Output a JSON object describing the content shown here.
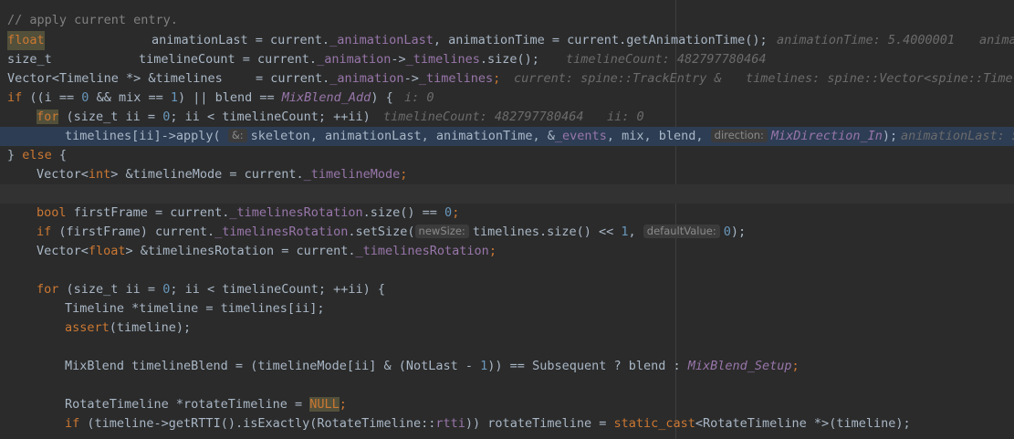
{
  "code": {
    "comment": "// apply current entry.",
    "l2_type": "float",
    "l2_lhs": "animationLast = current.",
    "l2_f1": "_animationLast",
    "l2_mid": ", animationTime = current.getAnimationTime();",
    "l2_hint1": "animationTime: 5.4000001",
    "l2_hint2": "anima",
    "l3_type": "size_t",
    "l3_lhs": "timelineCount = current.",
    "l3_f1": "_animation",
    "l3_arrow": "->",
    "l3_f2": "_timelines",
    "l3_rest": ".size();",
    "l3_hint": "timelineCount: 482797780464",
    "l4_type": "Vector<Timeline *> &timelines",
    "l4_eq": "= current.",
    "l4_f1": "_animation",
    "l4_arrow": "->",
    "l4_f2": "_timelines",
    "l4_semi": ";",
    "l4_hint1": "current: spine::TrackEntry &",
    "l4_hint2": "timelines: spine::Vector<spine::Timel",
    "l5_if": "if",
    "l5_a": " ((i == ",
    "l5_n0": "0",
    "l5_b": " && mix == ",
    "l5_n1": "1",
    "l5_c": ") || blend == ",
    "l5_en": "MixBlend_Add",
    "l5_d": ") {",
    "l5_hint": "i: 0",
    "l6_for": "for",
    "l6_a": " (size_t ii = ",
    "l6_n0": "0",
    "l6_b": "; ii < timelineCount; ++ii)",
    "l6_hint1": "timelineCount: 482797780464",
    "l6_hint2": "ii: 0",
    "l7_a": "timelines[ii]->apply(",
    "l7_p1": "&:",
    "l7_b": "skeleton, animationLast, animationTime, &",
    "l7_f": "_events",
    "l7_c": ", mix, blend,",
    "l7_p2": "direction:",
    "l7_en": "MixDirection_In",
    "l7_d": ");",
    "l7_hint": "animationLast: 5",
    "l8_a": "} ",
    "l8_else": "else",
    "l8_b": " {",
    "l9_a": "Vector<",
    "l9_int": "int",
    "l9_b": "> &timelineMode = current.",
    "l9_f": "_timelineMode",
    "l9_c": ";",
    "l11_bool": "bool",
    "l11_a": " firstFrame = current.",
    "l11_f": "_timelinesRotation",
    "l11_b": ".size() == ",
    "l11_n": "0",
    "l11_c": ";",
    "l12_if": "if",
    "l12_a": " (firstFrame) current.",
    "l12_f": "_timelinesRotation",
    "l12_b": ".setSize(",
    "l12_p1": "newSize:",
    "l12_c": "timelines.size() << ",
    "l12_n1": "1",
    "l12_d": ",",
    "l12_p2": "defaultValue:",
    "l12_n0": "0",
    "l12_e": ");",
    "l13_a": "Vector<",
    "l13_float": "float",
    "l13_b": "> &timelinesRotation = current.",
    "l13_f": "_timelinesRotation",
    "l13_c": ";",
    "l15_for": "for",
    "l15_a": " (size_t ii = ",
    "l15_n0": "0",
    "l15_b": "; ii < timelineCount; ++ii) {",
    "l16": "Timeline *timeline = timelines[ii];",
    "l17_fn": "assert",
    "l17_b": "(timeline);",
    "l19_a": "MixBlend timelineBlend = (timelineMode[ii] & (NotLast - ",
    "l19_n1": "1",
    "l19_b": ")) == Subsequent ? blend : ",
    "l19_en": "MixBlend_Setup",
    "l19_c": ";",
    "l21_a": "RotateTimeline *rotateTimeline = ",
    "l21_null": "NULL",
    "l21_b": ";",
    "l22_if": "if",
    "l22_a": " (timeline->getRTTI().isExactly(RotateTimeline::",
    "l22_rtti": "rtti",
    "l22_b": ")) rotateTimeline = ",
    "l22_sc": "static_cast",
    "l22_c": "<RotateTimeline *>(timeline);"
  },
  "colors": {
    "background": "#2b2b2b",
    "exec_line": "#2d3d54",
    "keyword": "#cc7832",
    "field": "#9876aa",
    "number": "#6897bb",
    "function": "#ffc66d",
    "hint": "#6b6b6b"
  }
}
